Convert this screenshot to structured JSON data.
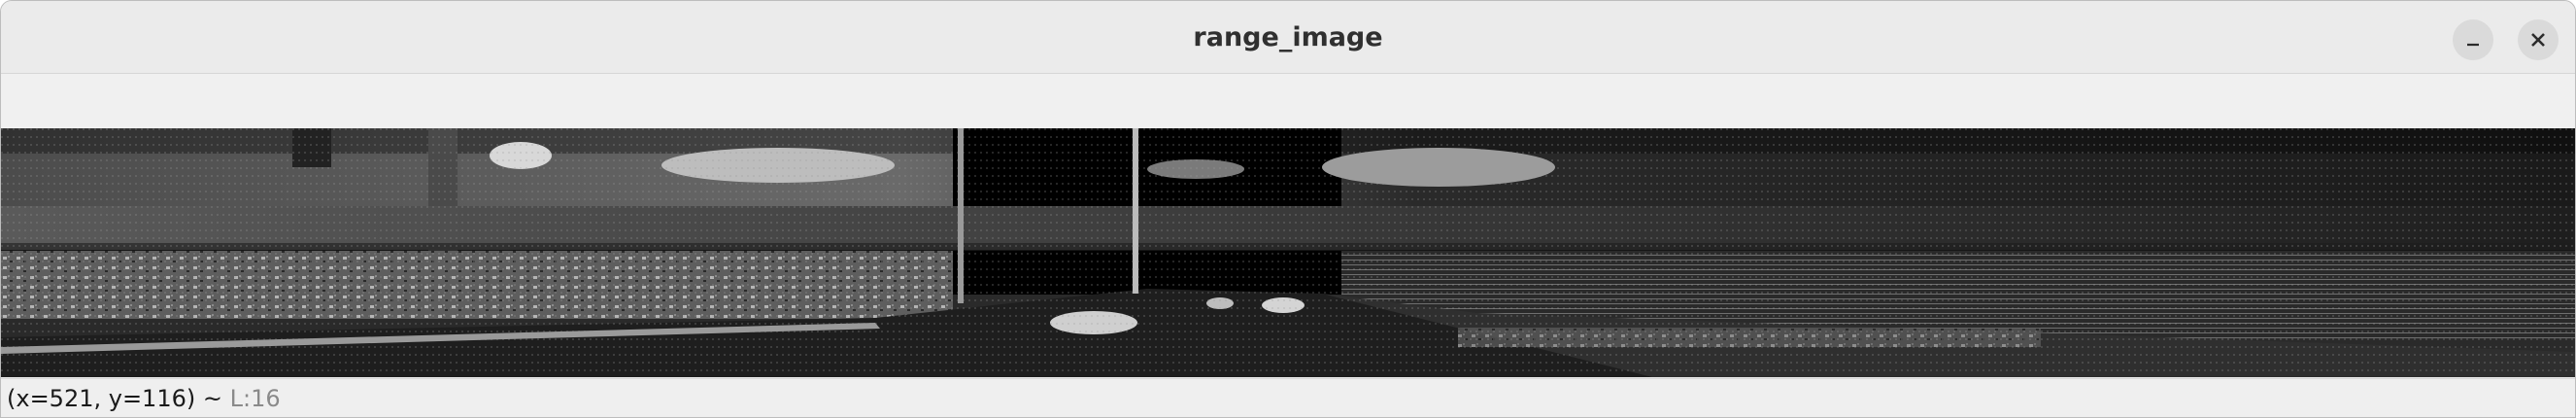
{
  "window": {
    "title": "range_image",
    "controls": {
      "minimize_icon": "minimize-icon",
      "close_icon": "close-icon"
    }
  },
  "image": {
    "description_icon": "range-image-canvas",
    "colors": {
      "background": "#0b0b0b",
      "sky": "#1a1a1a",
      "road": "#262626"
    }
  },
  "status": {
    "coords": "(x=521, y=116)",
    "separator": "~",
    "level": "L:16"
  }
}
